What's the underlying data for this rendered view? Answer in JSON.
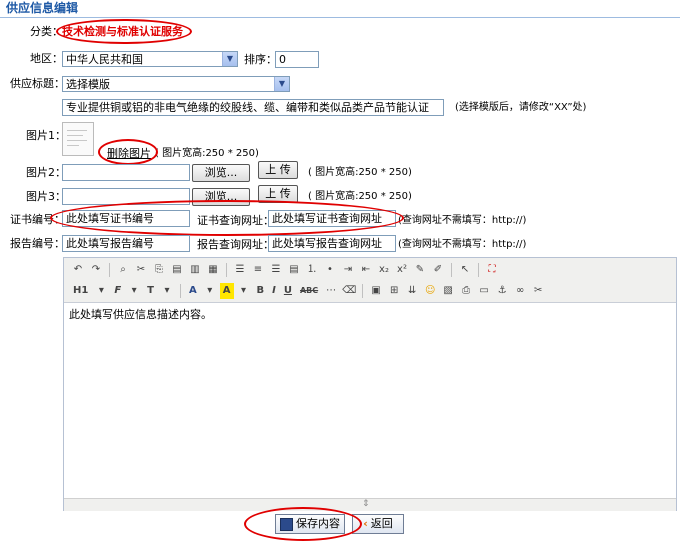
{
  "header": {
    "title": "供应信息编辑"
  },
  "form": {
    "category": {
      "label": "分类：",
      "value": "技术检测与标准认证服务"
    },
    "region": {
      "label": "地区：",
      "value": "中华人民共和国"
    },
    "sort": {
      "label": "排序：",
      "value": "0"
    },
    "supply_title": {
      "label": "供应标题：",
      "template_select": "选择模版",
      "value": "专业提供铜或铝的非电气绝缘的绞股线、缆、编带和类似品类产品节能认证",
      "hint": "(选择模版后，请修改“XX”处)"
    },
    "image1": {
      "label": "图片1：",
      "delete_label": "删除图片",
      "size_hint": "( 图片宽高:250 * 250)"
    },
    "image2": {
      "label": "图片2：",
      "browse": "浏览...",
      "upload": "上 传",
      "size_hint": "( 图片宽高:250 * 250)"
    },
    "image3": {
      "label": "图片3：",
      "browse": "浏览...",
      "upload": "上 传",
      "size_hint": "( 图片宽高:250 * 250)"
    },
    "cert": {
      "label": "证书编号：",
      "value": "此处填写证书编号",
      "query_label": "证书查询网址：",
      "query_value": "此处填写证书查询网址",
      "hint": "(查询网址不需填写：http://)"
    },
    "report": {
      "label": "报告编号：",
      "value": "此处填写报告编号",
      "query_label": "报告查询网址：",
      "query_value": "此处填写报告查询网址",
      "hint": "(查询网址不需填写：http://)"
    }
  },
  "editor": {
    "toolbar": {
      "heading": "H1",
      "font": "F",
      "size": "T",
      "color": "A",
      "bold": "B",
      "italic": "I",
      "underline": "U",
      "strike": "ABC"
    },
    "content": "此处填写供应信息描述内容。"
  },
  "actions": {
    "save": "保存内容",
    "back": "返回"
  },
  "colors": {
    "accent": "#1f5aa6",
    "highlight": "#e00000"
  }
}
